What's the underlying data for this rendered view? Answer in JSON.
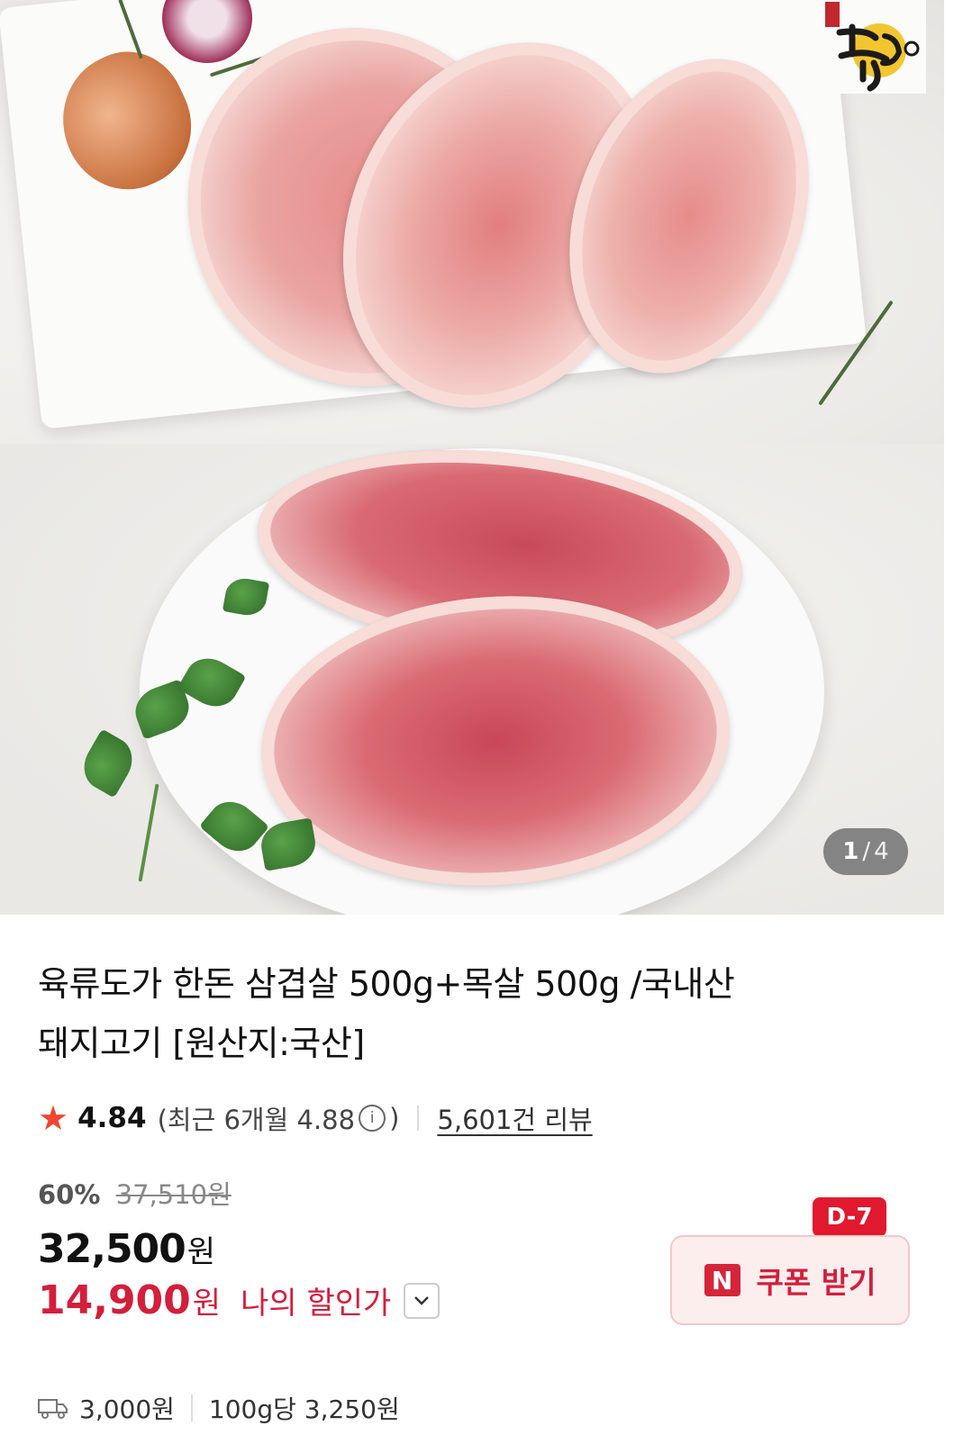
{
  "gallery": {
    "current": "1",
    "separator": "/",
    "total": "4",
    "logo_alt": "한돈 KOREA PORK"
  },
  "product": {
    "title_line1": "육류도가 한돈 삼겹살 500g+목살 500g /국내산",
    "title_line2": "돼지고기 [원산지:국산]"
  },
  "rating": {
    "score": "4.84",
    "recent_open": "(최근 6개월 4.88",
    "recent_close": ")",
    "reviews": "5,601건 리뷰"
  },
  "price": {
    "discount": "60%",
    "original": "37,510원",
    "current": "32,500",
    "current_unit": "원",
    "my_price": "14,900",
    "my_unit": "원",
    "my_label": "나의 할인가"
  },
  "coupon": {
    "badge": "D-7",
    "icon_text": "N",
    "label": "쿠폰 받기"
  },
  "delivery": {
    "fee": "3,000원",
    "unit_price": "100g당 3,250원"
  },
  "colors": {
    "accent_red": "#d31e3c",
    "star": "#f04631",
    "badge_red": "#e0192f"
  }
}
